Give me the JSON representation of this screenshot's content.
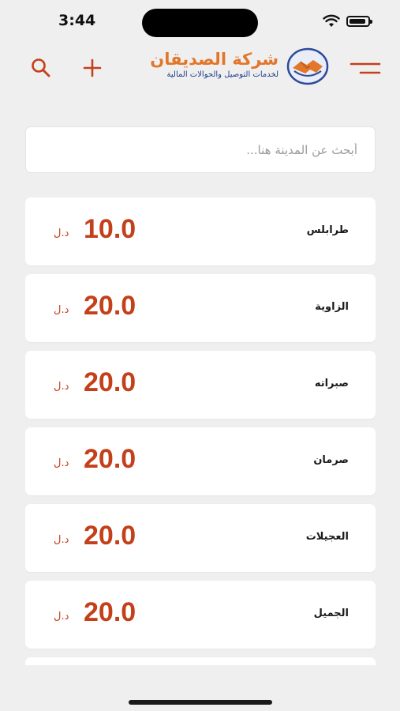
{
  "status_bar": {
    "time": "3:44"
  },
  "header": {
    "logo_title": "شركة الصديقان",
    "logo_subtitle": "لخدمات التوصيل والحوالات المالية",
    "accent_color": "#c4401a"
  },
  "search": {
    "placeholder": "أبحث عن المدينة هنا..."
  },
  "cities": [
    {
      "name": "طرابلس",
      "price": "10.0",
      "currency": "د.ل"
    },
    {
      "name": "الزاوية",
      "price": "20.0",
      "currency": "د.ل"
    },
    {
      "name": "صبراته",
      "price": "20.0",
      "currency": "د.ل"
    },
    {
      "name": "صرمان",
      "price": "20.0",
      "currency": "د.ل"
    },
    {
      "name": "العجيلات",
      "price": "20.0",
      "currency": "د.ل"
    },
    {
      "name": "الجميل",
      "price": "20.0",
      "currency": "د.ل"
    },
    {
      "name": "",
      "price": "",
      "currency": ""
    }
  ]
}
